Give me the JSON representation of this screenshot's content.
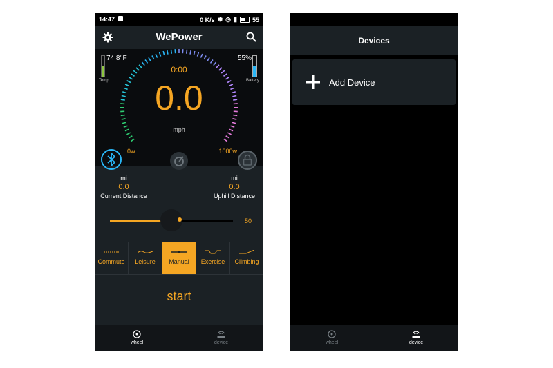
{
  "status_bar": {
    "time": "14:47",
    "data_rate": "0 K/s",
    "battery": "55"
  },
  "wheel_screen": {
    "title": "WePower",
    "temperature": {
      "value": "74.8°F",
      "label": "Temp.",
      "level": 0.55
    },
    "battery": {
      "value": "55%",
      "label": "Battery",
      "level": 0.55
    },
    "timer": "0:00",
    "speed": "0.0",
    "speed_unit": "mph",
    "power_min": "0w",
    "power_max": "1000w",
    "current_distance": {
      "unit": "mi",
      "value": "0.0",
      "label": "Current Distance"
    },
    "uphill_distance": {
      "unit": "mi",
      "value": "0.0",
      "label": "Uphill Distance"
    },
    "slider": {
      "value": "50",
      "fraction": 0.5
    },
    "modes": [
      {
        "label": "Commute",
        "active": false
      },
      {
        "label": "Leisure",
        "active": false
      },
      {
        "label": "Manual",
        "active": true
      },
      {
        "label": "Exercise",
        "active": false
      },
      {
        "label": "Climbing",
        "active": false
      }
    ],
    "start_label": "start",
    "accent": "#f5a623"
  },
  "devices_screen": {
    "title": "Devices",
    "add_device_label": "Add Device"
  },
  "nav": {
    "wheel": "wheel",
    "device": "device"
  }
}
